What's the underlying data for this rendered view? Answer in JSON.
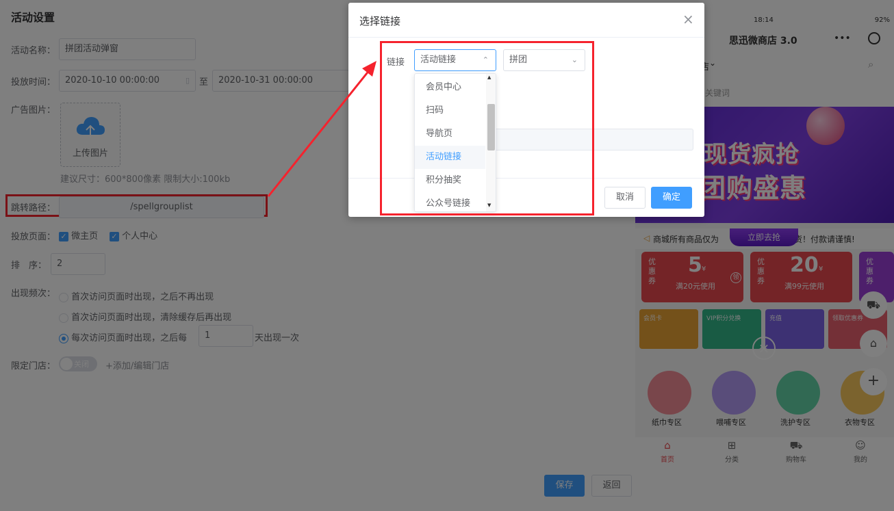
{
  "form": {
    "title": "活动设置",
    "name_label": "活动名称：",
    "name_value": "拼团活动弹窗",
    "time_label": "投放时间：",
    "start_time": "2020-10-10 00:00:00",
    "to_label": "至",
    "end_time": "2020-10-31 00:00:00",
    "image_label": "广告图片：",
    "upload_label": "上传图片",
    "image_hint": "建议尺寸：600*800像素 限制大小:100kb",
    "path_label": "跳转路径：",
    "path_value": "/spellgrouplist",
    "page_label": "投放页面：",
    "page_options": [
      "微主页",
      "个人中心"
    ],
    "sort_label": "排　序：",
    "sort_value": "2",
    "freq_label": "出现频次：",
    "freq_options": [
      "首次访问页面时出现，之后不再出现",
      "首次访问页面时出现，清除缓存后再出现"
    ],
    "freq_third_prefix": "每次访问页面时出现，之后每",
    "freq_days": "1",
    "freq_third_suffix": "天出现一次",
    "store_label": "限定门店：",
    "store_toggle": "关闭",
    "store_add": "+添加/编辑门店",
    "save_label": "保存",
    "back_label": "返回"
  },
  "phone": {
    "time": "18:14",
    "battery": "92%",
    "title": "思迅微商店 3.0",
    "store_suffix": "店",
    "search_hint": "关键词",
    "banner_line1": "现货疯抢",
    "banner_line2": "团购盛惠",
    "notice": "商城所有商品仅为",
    "notice_tail": "发货！付款请谨慎!",
    "promo_button": "立即去抢",
    "coupon_side": "优惠券",
    "coupon1_amount": "5",
    "coupon1_cond": "满20元使用",
    "coupon2_amount": "20",
    "coupon2_cond": "满99元使用",
    "yen": "¥",
    "grab": "领",
    "categories": [
      "纸巾专区",
      "喂哺专区",
      "洗护专区",
      "衣物专区"
    ],
    "mini_cards": [
      "会员卡",
      "VIP积分兑换",
      "充值",
      "领取优惠券"
    ],
    "tabs": [
      "首页",
      "分类",
      "购物车",
      "我的"
    ]
  },
  "dialog": {
    "title": "选择链接",
    "link_label": "链接",
    "select1": "活动链接",
    "select2": "拼团",
    "options": [
      "会员中心",
      "扫码",
      "导航页",
      "活动链接",
      "积分抽奖",
      "公众号链接"
    ],
    "selected_index": 3,
    "cancel_label": "取消",
    "ok_label": "确定"
  },
  "colors": {
    "primary": "#409eff",
    "annotation": "#f5222d",
    "overlay": "rgba(0,0,0,0.5)"
  }
}
